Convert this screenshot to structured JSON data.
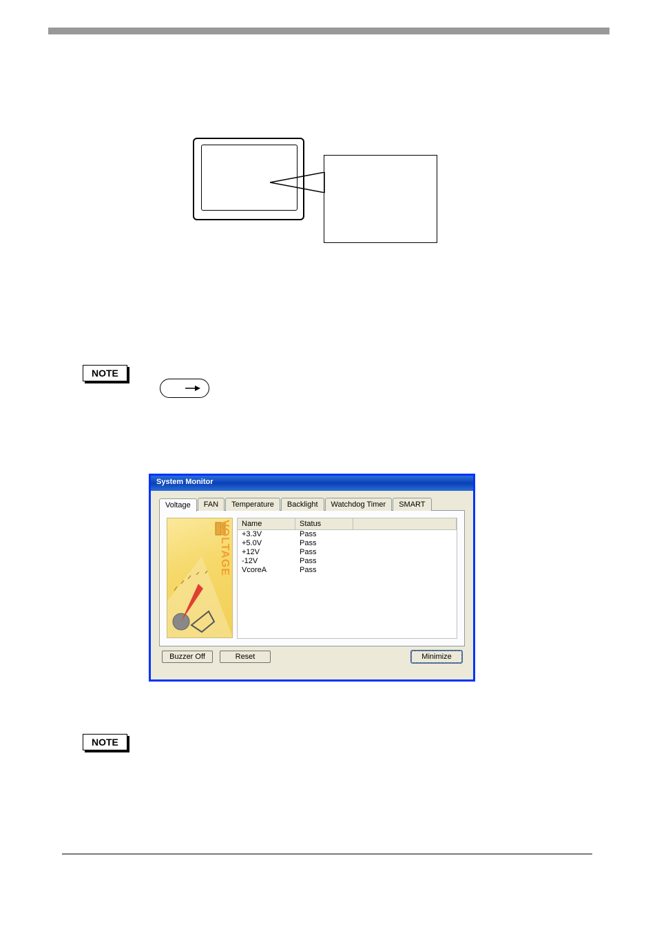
{
  "noteLabel": "NOTE",
  "window": {
    "title": "System Monitor",
    "tabs": [
      "Voltage",
      "FAN",
      "Temperature",
      "Backlight",
      "Watchdog Timer",
      "SMART"
    ],
    "activeTab": 0,
    "gaugeLabel": "VOLTAGE",
    "columns": {
      "name": "Name",
      "status": "Status"
    },
    "rows": [
      {
        "name": "+3.3V",
        "status": "Pass"
      },
      {
        "name": "+5.0V",
        "status": "Pass"
      },
      {
        "name": "+12V",
        "status": "Pass"
      },
      {
        "name": "-12V",
        "status": "Pass"
      },
      {
        "name": "VcoreA",
        "status": "Pass"
      }
    ],
    "buttons": {
      "buzzerOff": "Buzzer Off",
      "reset": "Reset",
      "minimize": "Minimize"
    }
  }
}
